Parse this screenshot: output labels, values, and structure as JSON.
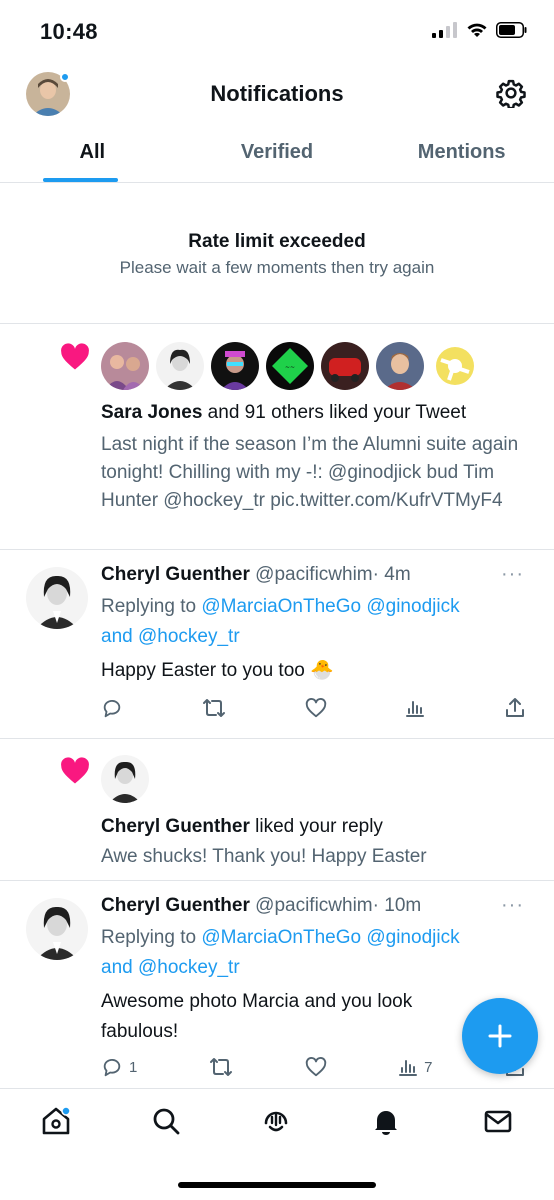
{
  "status_bar": {
    "time": "10:48"
  },
  "header": {
    "title": "Notifications"
  },
  "tabs": [
    {
      "label": "All",
      "active": true
    },
    {
      "label": "Verified",
      "active": false
    },
    {
      "label": "Mentions",
      "active": false
    }
  ],
  "rate_limit": {
    "title": "Rate limit exceeded",
    "subtitle": "Please wait a few moments then try again"
  },
  "like_notification": {
    "actor": "Sara Jones",
    "action": " and 91 others liked your Tweet",
    "tweet_text": "Last night if the season I’m the Alumni suite again tonight! Chilling with my -!: @ginodjick bud Tim Hunter @hockey_tr pic.twitter.com/KufrVTMyF4"
  },
  "tweet1": {
    "name": "Cheryl Guenther",
    "handle": "@pacificwhim",
    "time": "· 4m",
    "reply_prefix": "Replying to ",
    "reply_user1": "@MarciaOnTheGo",
    "reply_user2": "@ginodjick",
    "reply_and": "and ",
    "reply_user3": "@hockey_tr",
    "body": "Happy Easter to you too 🐣",
    "more": "···"
  },
  "liked_reply_notification": {
    "actor": "Cheryl Guenther",
    "action": " liked your reply",
    "reply_text": "Awe shucks! Thank you! Happy Easter"
  },
  "tweet2": {
    "name": "Cheryl Guenther",
    "handle": "@pacificwhim",
    "time": "· 10m",
    "reply_prefix": "Replying to ",
    "reply_user1": "@MarciaOnTheGo",
    "reply_user2": "@ginodjick",
    "reply_and": "and ",
    "reply_user3": "@hockey_tr",
    "body": "Awesome photo Marcia and you look fabulous!",
    "reply_count": "1",
    "views_count": "7",
    "more": "···"
  },
  "colors": {
    "accent": "#1d9bf0",
    "heart": "#f91880",
    "muted": "#536471"
  },
  "icons": [
    "signal-icon",
    "wifi-icon",
    "battery-icon",
    "gear-icon",
    "heart-icon",
    "reply-icon",
    "retweet-icon",
    "like-icon",
    "views-icon",
    "share-icon",
    "compose-icon",
    "home-icon",
    "search-icon",
    "spaces-icon",
    "bell-icon",
    "mail-icon"
  ]
}
